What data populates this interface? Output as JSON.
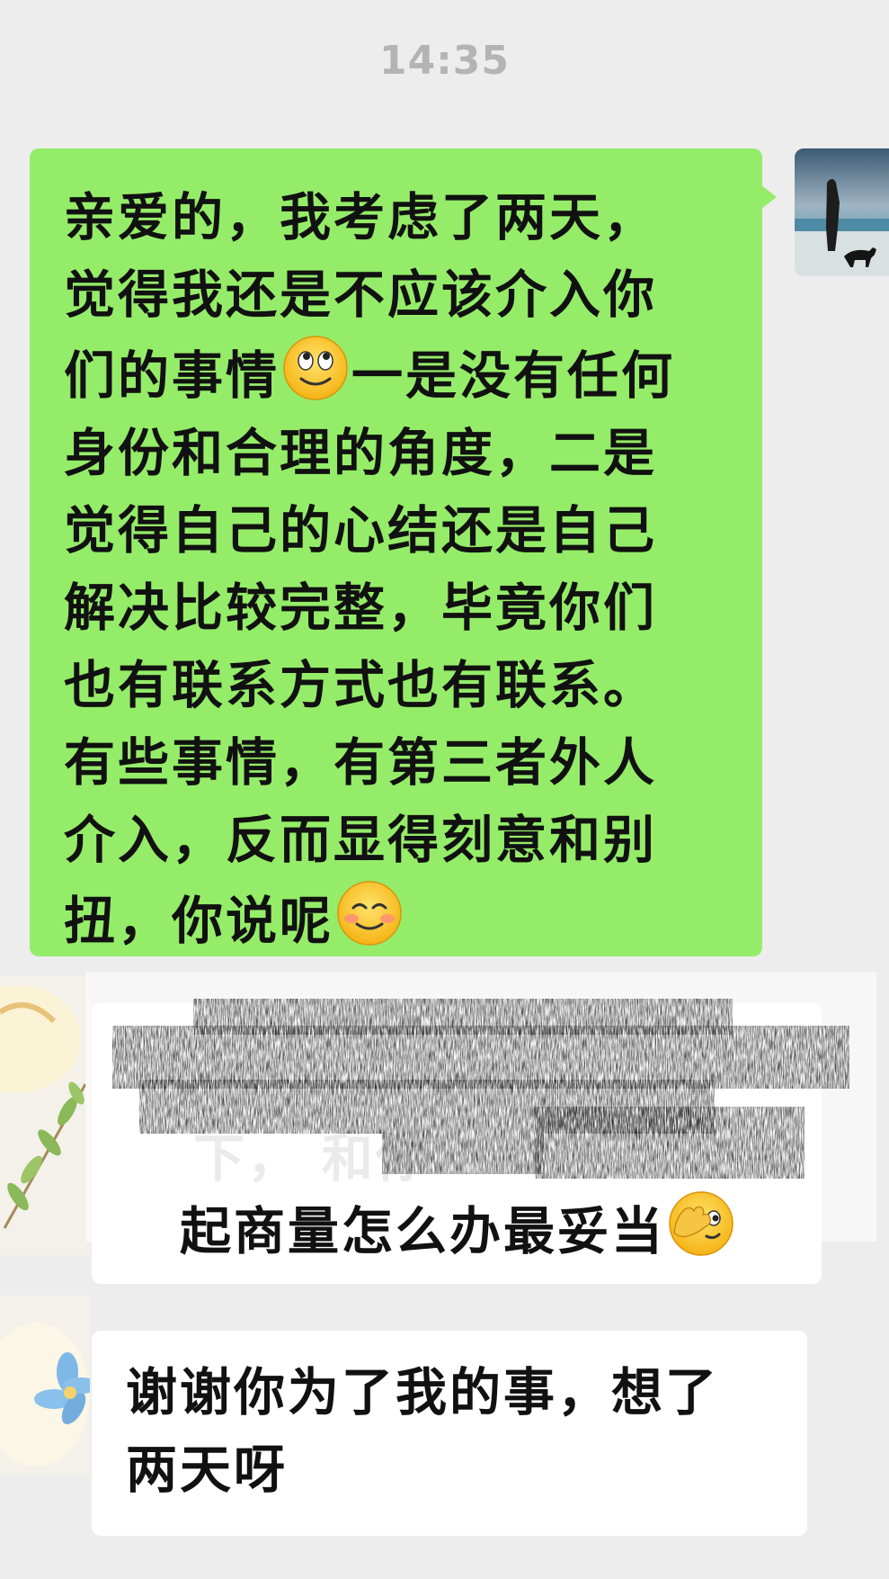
{
  "timestamp": "14:35",
  "messages": {
    "outgoing_1": {
      "lines": [
        "亲爱的，我考虑了两天，",
        "觉得我还是不应该介入你",
        "们的事情",
        "一是没有任何",
        "身份和合理的角度，二是",
        "觉得自己的心结还是自己",
        "解决比较完整，毕竟你们",
        "也有联系方式也有联系。",
        "有些事情，有第三者外人",
        "介入，反而显得刻意和别",
        "扭，你说呢"
      ],
      "emoji_1": "rolling-eyes-smile-emoji",
      "emoji_2": "blushing-smile-emoji"
    },
    "incoming_1": {
      "partial_line_1": "下，      和你        ",
      "line_2": "起商量怎么办最妥当",
      "emoji": "facepalm-peek-emoji",
      "redaction": "scribbled-out-text"
    },
    "incoming_2": {
      "line_1": "谢谢你为了我的事，想了",
      "line_2": "两天呀"
    }
  },
  "colors": {
    "background": "#ededed",
    "outgoing_bubble": "#95ec69",
    "incoming_bubble": "#ffffff",
    "timestamp": "#b4b4b4",
    "text": "#111111"
  }
}
